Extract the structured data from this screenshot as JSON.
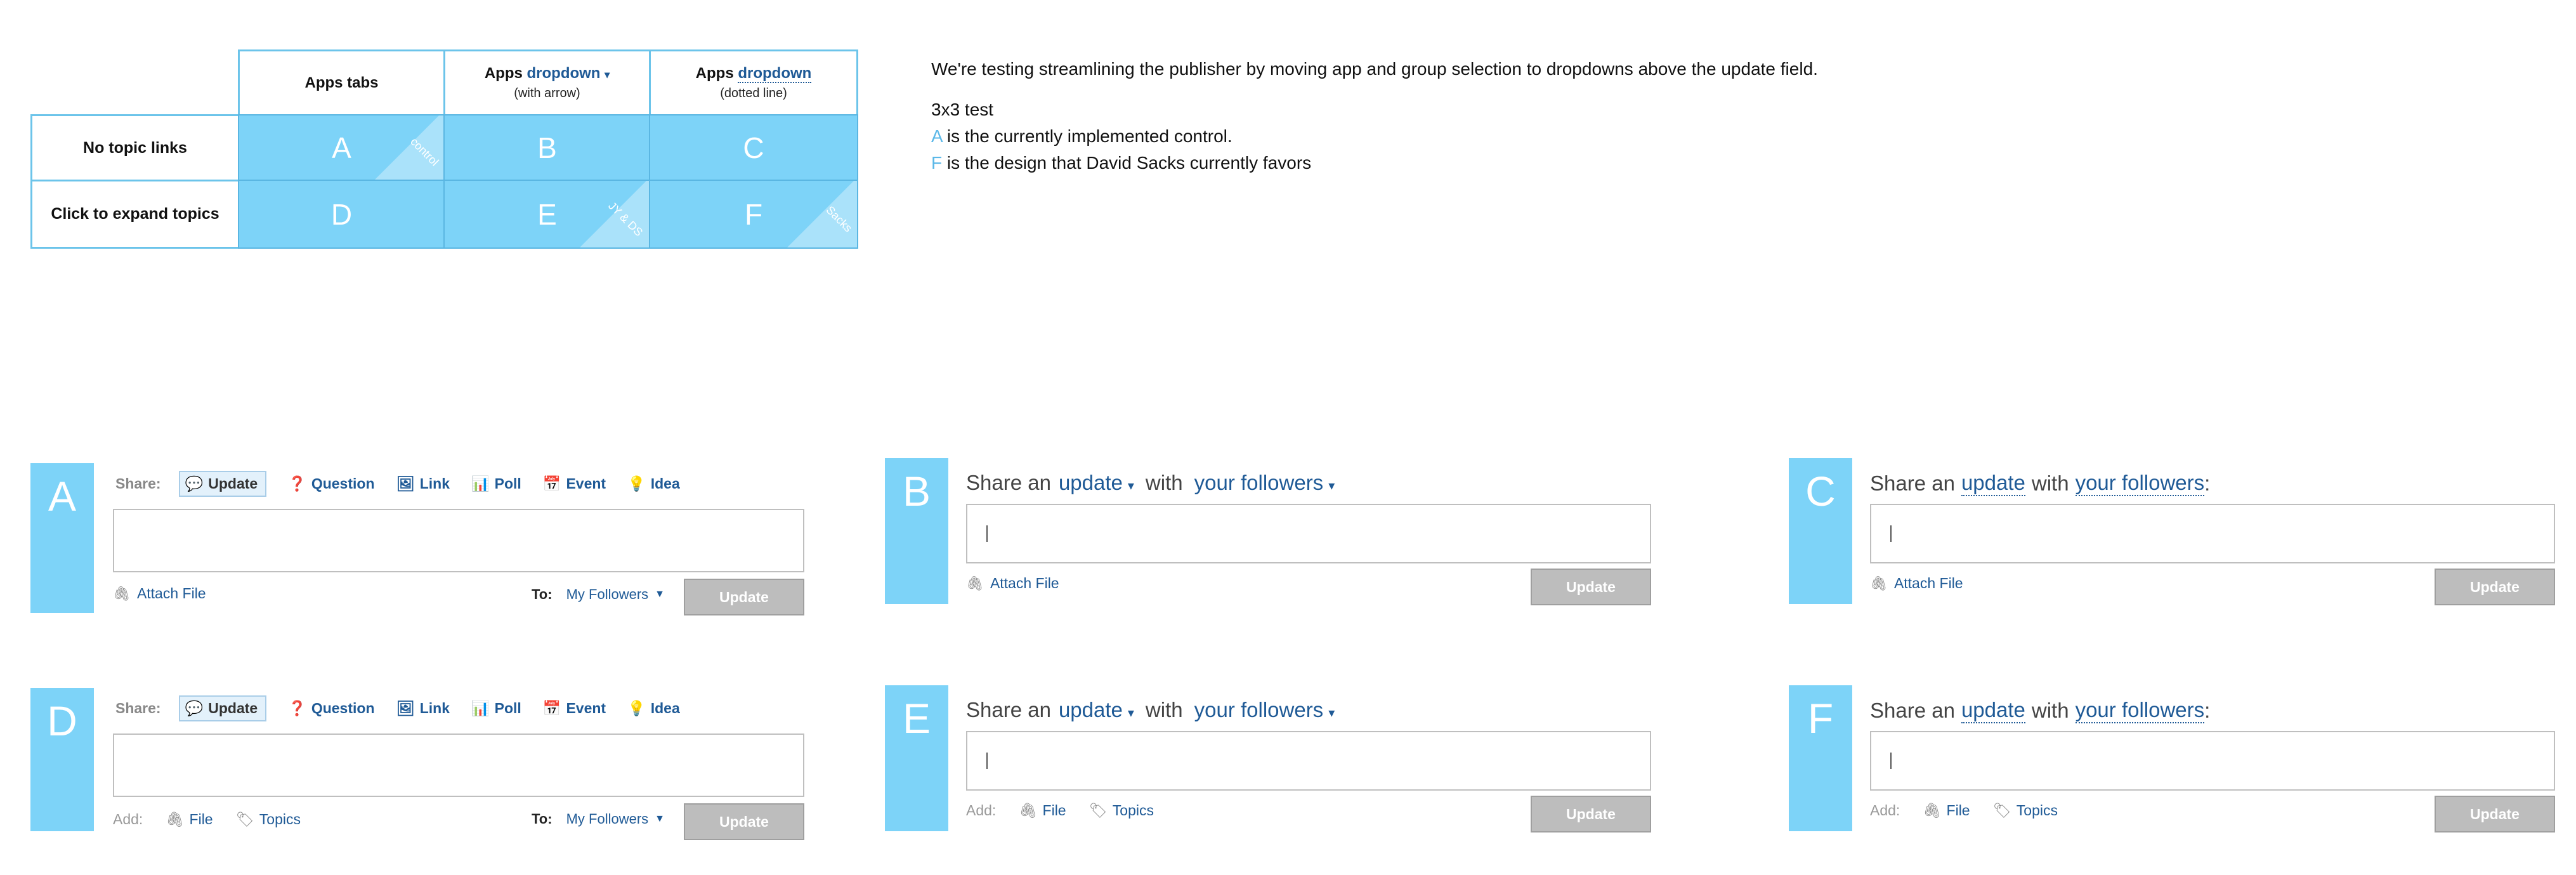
{
  "matrix": {
    "col_headers": [
      {
        "title": "Apps tabs",
        "link": "",
        "sub": "",
        "style": "none"
      },
      {
        "title": "Apps",
        "link": "dropdown",
        "arrow": "▾",
        "sub": "(with arrow)",
        "style": "arrow"
      },
      {
        "title": "Apps",
        "link": "dropdown",
        "sub": "(dotted line)",
        "style": "dotted"
      }
    ],
    "row_labels": [
      "No topic links",
      "Click to expand topics"
    ],
    "cells": [
      {
        "letter": "A",
        "ribbon": "control"
      },
      {
        "letter": "B",
        "ribbon": ""
      },
      {
        "letter": "C",
        "ribbon": ""
      },
      {
        "letter": "D",
        "ribbon": ""
      },
      {
        "letter": "E",
        "ribbon": "JY & DS"
      },
      {
        "letter": "F",
        "ribbon": "Sacks"
      }
    ]
  },
  "notes": {
    "intro": "We're testing streamlining the publisher by moving app and group selection to dropdowns above the update field.",
    "test": "3x3 test",
    "a_key": "A",
    "a_text": " is the currently implemented control.",
    "f_key": "F",
    "f_text": " is the design that David Sacks currently favors"
  },
  "tabs_variant": {
    "share_label": "Share:",
    "tabs": [
      {
        "label": "Update",
        "icon": "speech-bubble-icon"
      },
      {
        "label": "Question",
        "icon": "question-icon"
      },
      {
        "label": "Link",
        "icon": "link-icon"
      },
      {
        "label": "Poll",
        "icon": "poll-icon"
      },
      {
        "label": "Event",
        "icon": "calendar-icon"
      },
      {
        "label": "Idea",
        "icon": "lightbulb-icon"
      }
    ],
    "attach_file": "Attach File",
    "add_label": "Add:",
    "file": "File",
    "topics": "Topics",
    "to_label": "To:",
    "to_value": "My Followers",
    "update_button": "Update"
  },
  "dropdown_variant": {
    "share_an": "Share an",
    "update": "update",
    "with": "with",
    "followers": "your followers",
    "colon": ":",
    "attach_file": "Attach File",
    "add_label": "Add:",
    "file": "File",
    "topics": "Topics",
    "update_button": "Update"
  },
  "panels": {
    "A": "A",
    "B": "B",
    "C": "C",
    "D": "D",
    "E": "E",
    "F": "F"
  },
  "colors": {
    "accent": "#7dd3f8",
    "link": "#1f5a96",
    "button": "#bdbdbd"
  }
}
